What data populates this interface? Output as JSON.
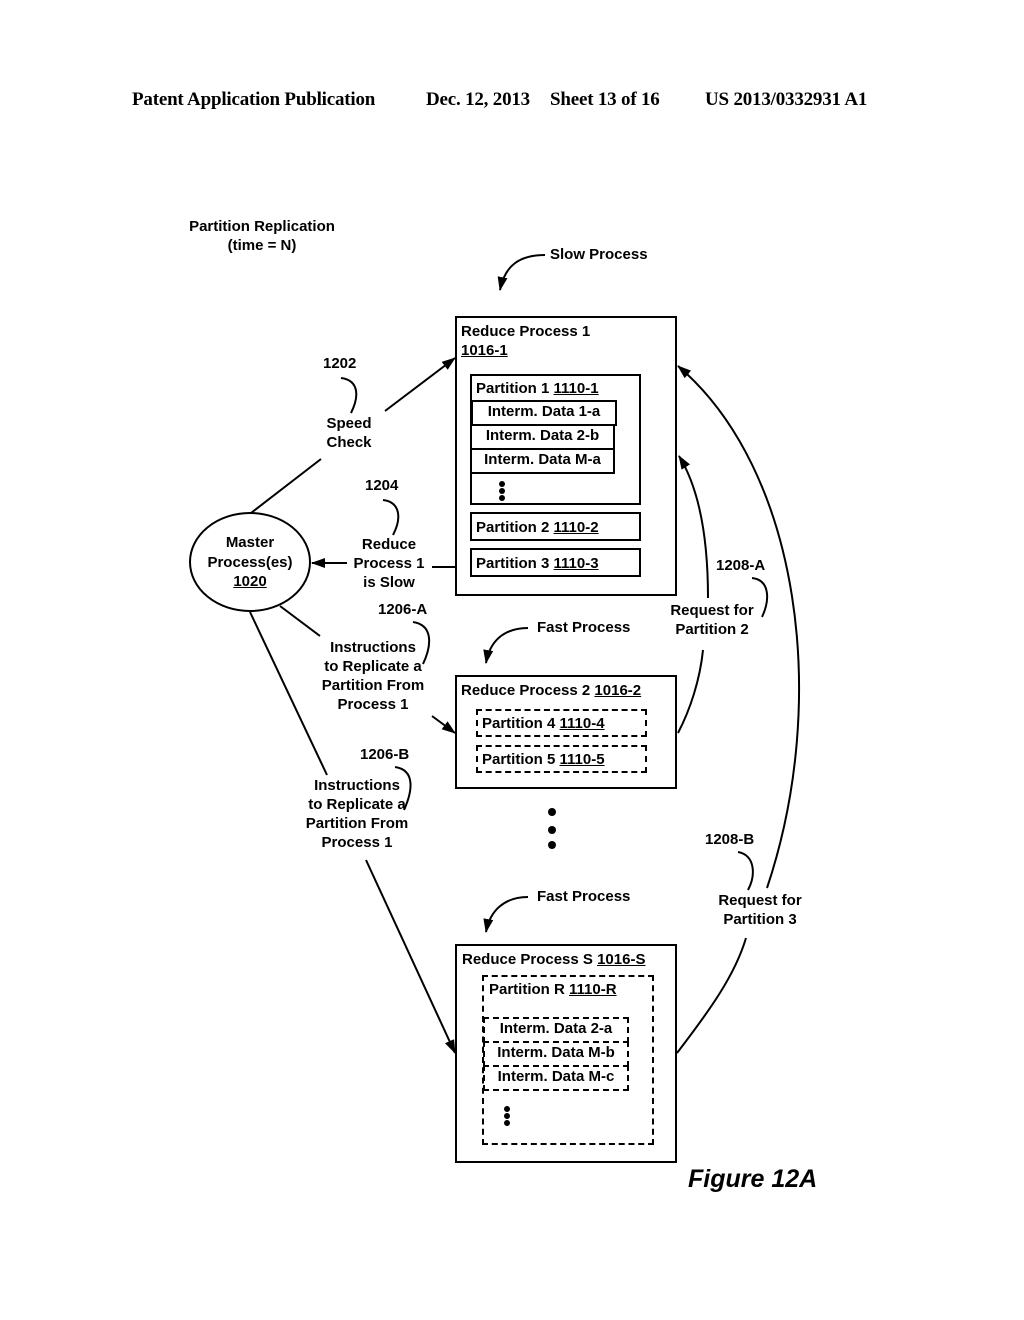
{
  "header": {
    "publication": "Patent Application Publication",
    "date": "Dec. 12, 2013",
    "sheet": "Sheet 13 of 16",
    "patent_number": "US 2013/0332931 A1"
  },
  "diagram": {
    "title_line1": "Partition Replication",
    "title_line2": "(time = N)",
    "slow_process_label": "Slow Process",
    "fast_process_label_1": "Fast Process",
    "fast_process_label_2": "Fast Process",
    "master": {
      "line1": "Master",
      "line2": "Process(es)",
      "ref": "1020"
    },
    "reduce_process_1": {
      "title": "Reduce Process 1",
      "ref": "1016-1",
      "partition_1": {
        "label": "Partition 1",
        "ref": "1110-1",
        "items": [
          "Interm. Data 1-a",
          "Interm. Data 2-b",
          "Interm. Data M-a"
        ]
      },
      "partition_2": {
        "label": "Partition 2",
        "ref": "1110-2"
      },
      "partition_3": {
        "label": "Partition 3",
        "ref": "1110-3"
      }
    },
    "reduce_process_2": {
      "title": "Reduce Process 2",
      "ref": "1016-2",
      "partition_4": {
        "label": "Partition 4",
        "ref": "1110-4"
      },
      "partition_5": {
        "label": "Partition 5",
        "ref": "1110-5"
      }
    },
    "reduce_process_s": {
      "title": "Reduce Process S",
      "ref": "1016-S",
      "partition_r": {
        "label": "Partition R",
        "ref": "1110-R",
        "items": [
          "Interm. Data 2-a",
          "Interm. Data M-b",
          "Interm. Data M-c"
        ]
      }
    },
    "annotations": {
      "ref_1202": "1202",
      "speed_check_1": "Speed",
      "speed_check_2": "Check",
      "ref_1204": "1204",
      "slow_1": "Reduce",
      "slow_2": "Process 1",
      "slow_3": "is Slow",
      "ref_1206a": "1206-A",
      "instr_a": [
        "Instructions",
        "to Replicate a",
        "Partition From",
        "Process 1"
      ],
      "ref_1206b": "1206-B",
      "instr_b": [
        "Instructions",
        "to Replicate a",
        "Partition From",
        "Process 1"
      ],
      "ref_1208a": "1208-A",
      "req_a_1": "Request for",
      "req_a_2": "Partition 2",
      "ref_1208b": "1208-B",
      "req_b_1": "Request for",
      "req_b_2": "Partition 3"
    },
    "figure_label": "Figure 12A"
  }
}
